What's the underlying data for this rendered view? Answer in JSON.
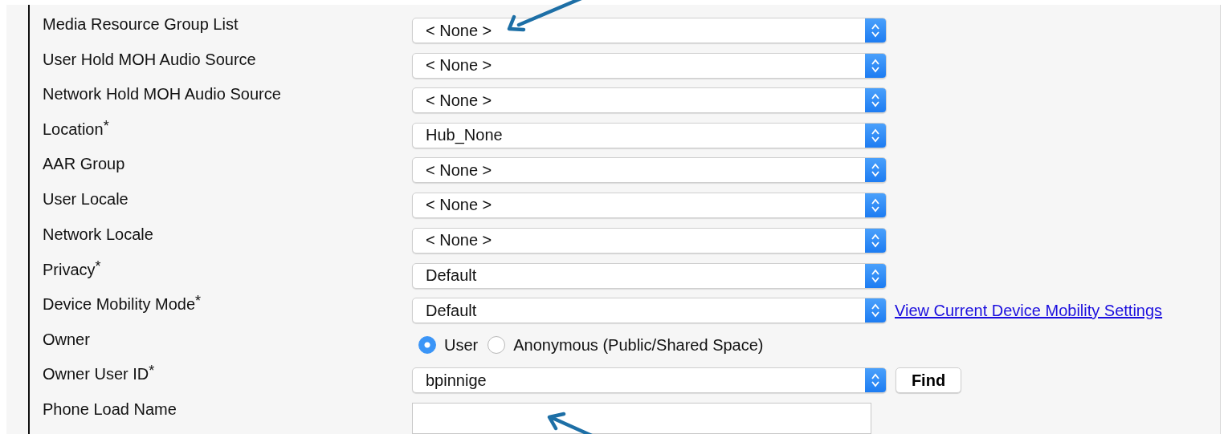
{
  "fields": [
    {
      "label": "Media Resource Group List",
      "kind": "select",
      "value": "< None >"
    },
    {
      "label": "User Hold MOH Audio Source",
      "kind": "select",
      "value": "< None >"
    },
    {
      "label": "Network Hold MOH Audio Source",
      "kind": "select",
      "value": "< None >"
    },
    {
      "label": "Location$^{*}$",
      "kind": "select",
      "value": "Hub_None"
    },
    {
      "label": "AAR Group",
      "kind": "select",
      "value": "< None >"
    },
    {
      "label": "User Locale",
      "kind": "select",
      "value": "< None >"
    },
    {
      "label": "Network Locale",
      "kind": "select",
      "value": "< None >"
    },
    {
      "label": "Privacy$^{*}$",
      "kind": "select",
      "value": "Default"
    },
    {
      "label": "Device Mobility Mode$^{*}$",
      "kind": "select",
      "value": "Default",
      "link": "View Current Device Mobility Settings"
    },
    {
      "label": "Owner",
      "kind": "radio",
      "options": [
        {
          "label": "User",
          "selected": true
        },
        {
          "label": "Anonymous (Public/Shared Space)",
          "selected": false
        }
      ]
    },
    {
      "label": "Owner User ID$^{*}$",
      "kind": "select",
      "value": "bpinnige",
      "button": "Find"
    },
    {
      "label": "Phone Load Name",
      "kind": "text"
    }
  ]
}
